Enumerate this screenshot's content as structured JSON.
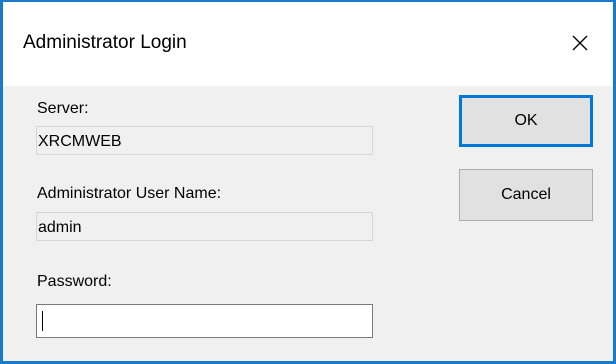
{
  "window": {
    "title": "Administrator Login",
    "close_icon": "close-icon"
  },
  "fields": {
    "server_label": "Server:",
    "server_value": "XRCMWEB",
    "username_label": "Administrator User Name:",
    "username_value": "admin",
    "password_label": "Password:",
    "password_value": ""
  },
  "buttons": {
    "ok_label": "OK",
    "cancel_label": "Cancel"
  },
  "colors": {
    "window_border": "#1979ca",
    "dialog_background": "#f0f0f0",
    "default_button_border": "#0078d7"
  }
}
